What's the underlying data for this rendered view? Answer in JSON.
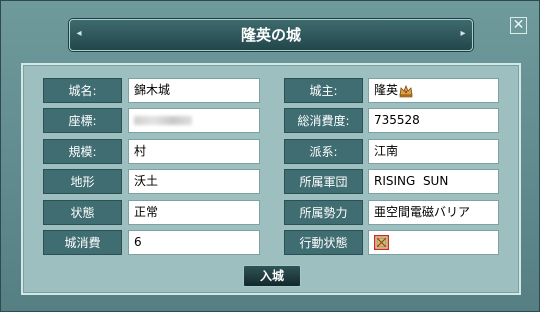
{
  "dialog": {
    "title": "隆英の城",
    "close_icon": "close-icon",
    "enter_label": "入城"
  },
  "left_fields": [
    {
      "label": "城名:",
      "value": "錦木城"
    },
    {
      "label": "座標:",
      "value": ""
    },
    {
      "label": "規模:",
      "value": "村"
    },
    {
      "label": "地形",
      "value": "沃土"
    },
    {
      "label": "状態",
      "value": "正常"
    },
    {
      "label": "城消費",
      "value": "6"
    }
  ],
  "right_fields": [
    {
      "label": "城主:",
      "value": "隆英",
      "icon": "crown-icon"
    },
    {
      "label": "総消費度:",
      "value": "735528"
    },
    {
      "label": "派系:",
      "value": "江南"
    },
    {
      "label": "所属軍団",
      "value": "RISING  SUN"
    },
    {
      "label": "所属勢力",
      "value": "亜空間電磁バリア"
    },
    {
      "label": "行動状態",
      "value": "",
      "icon": "status-icon"
    }
  ]
}
